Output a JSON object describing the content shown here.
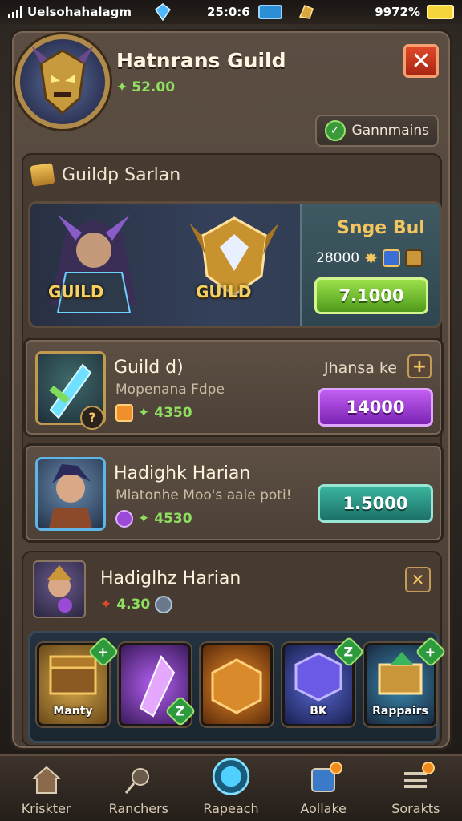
{
  "status_bar": {
    "carrier": "Uelsohahalagm",
    "time": "25:0:6",
    "battery": "9972%"
  },
  "header": {
    "title": "Hatnrans Guild",
    "points": "52.00",
    "close_label": "✕",
    "channels_label": "Gannmains"
  },
  "section": {
    "title": "Guildp Sarlan"
  },
  "banner": {
    "tag_left": "GUILD",
    "tag_right": "GUILD",
    "offer_title": "Snge Bul",
    "offer_cost": "28000",
    "buy_label": "7.1000"
  },
  "rows": [
    {
      "title": "Guild d)",
      "subtitle": "Mopenana Fdpe",
      "points": "4350",
      "right_label": "Jhansa ke",
      "plus_label": "+",
      "price": "14000"
    },
    {
      "title": "Hadighk Harian",
      "subtitle": "Mlatonhe Moo's aale poti!",
      "points": "4530",
      "price": "1.5000"
    }
  ],
  "lower": {
    "title": "Hadiglhz Harian",
    "points": "4.30",
    "close_label": "✕",
    "items": [
      {
        "label": "Manty",
        "badge": "+"
      },
      {
        "label": "",
        "badge": "Z"
      },
      {
        "label": "",
        "badge": ""
      },
      {
        "label": "BK",
        "badge": "Z"
      },
      {
        "label": "Rappairs",
        "badge": "+"
      }
    ]
  },
  "nav": [
    {
      "label": "Kriskter"
    },
    {
      "label": "Ranchers"
    },
    {
      "label": "Rapeach"
    },
    {
      "label": "Aollake"
    },
    {
      "label": "Sorakts"
    }
  ],
  "colors": {
    "accent_green": "#8fe060",
    "gold": "#f2c560",
    "purple": "#c15ff2",
    "teal": "#3ab59e"
  }
}
